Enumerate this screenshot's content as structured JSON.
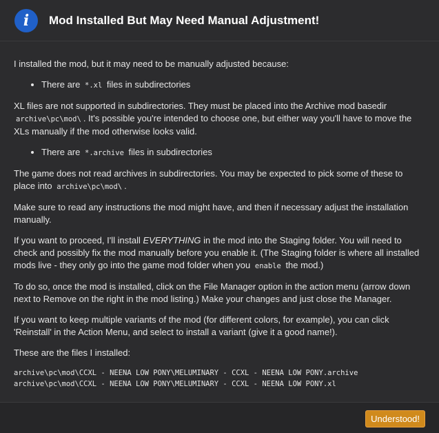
{
  "header": {
    "icon": "info-icon",
    "title": "Mod Installed But May Need Manual Adjustment!"
  },
  "body": {
    "intro": "I installed the mod, but it may need to be manually adjusted because:",
    "bullet1": {
      "pre": "There are",
      "code": "*.xl",
      "post": "files in subdirectories"
    },
    "xl_para": {
      "text1": "XL files are not supported in subdirectories. They must be placed into the Archive mod basedir",
      "code": "archive\\pc\\mod\\",
      "text2": ". It's possible you're intended to choose one, but either way you'll have to move the XLs manually if the mod otherwise looks valid."
    },
    "bullet2": {
      "pre": "There are",
      "code": "*.archive",
      "post": "files in subdirectories"
    },
    "archive_para": {
      "text1": "The game does not read archives in subdirectories. You may be expected to pick some of these to place into",
      "code": "archive\\pc\\mod\\",
      "text2": "."
    },
    "instructions_para": "Make sure to read any instructions the mod might have, and then if necessary adjust the installation manually.",
    "proceed_para": {
      "text1": "If you want to proceed, I'll install",
      "emphasis": "EVERYTHING",
      "text2": "in the mod into the Staging folder. You will need to check and possibly fix the mod manually before you enable it. (The Staging folder is where all installed mods live - they only go into the game mod folder when you",
      "code": "enable",
      "text3": "the mod.)"
    },
    "file_manager_para": "To do so, once the mod is installed, click on the File Manager option in the action menu (arrow down next to Remove on the right in the mod listing.) Make your changes and just close the Manager.",
    "variants_para": "If you want to keep multiple variants of the mod (for different colors, for example), you can click 'Reinstall' in the Action Menu, and select to install a variant (give it a good name!).",
    "files_heading": "These are the files I installed:",
    "files": [
      "archive\\pc\\mod\\CCXL - NEENA LOW PONY\\MELUMINARY - CCXL - NEENA LOW PONY.archive",
      "archive\\pc\\mod\\CCXL - NEENA LOW PONY\\MELUMINARY - CCXL - NEENA LOW PONY.xl"
    ]
  },
  "footer": {
    "button_label": "Understood!"
  },
  "colors": {
    "background": "#2c2c2e",
    "icon_blue": "#2060c8",
    "button_orange": "#d08a1c",
    "text": "#e6e6e6"
  }
}
